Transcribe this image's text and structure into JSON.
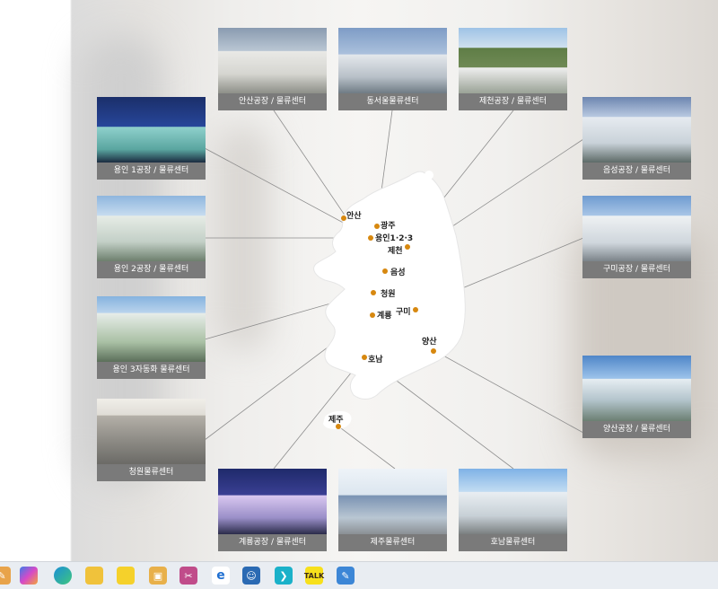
{
  "facilities": [
    {
      "id": "ansan",
      "caption": "안산공장 / 물류센터"
    },
    {
      "id": "dongseo",
      "caption": "동서울물류센터"
    },
    {
      "id": "jecheon",
      "caption": "제천공장 / 물류센터"
    },
    {
      "id": "yongin1",
      "caption": "용인 1공장 / 물류센터"
    },
    {
      "id": "eumseong",
      "caption": "음성공장 / 물류센터"
    },
    {
      "id": "yongin2",
      "caption": "용인 2공장 / 물류센터"
    },
    {
      "id": "gumi",
      "caption": "구미공장 / 물류센터"
    },
    {
      "id": "yongin3",
      "caption": "용인 3자동화 물류센터"
    },
    {
      "id": "yangsan",
      "caption": "양산공장 / 물류센터"
    },
    {
      "id": "cheongwon",
      "caption": "청원물류센터"
    },
    {
      "id": "gyeryong",
      "caption": "계룡공장 / 물류센터"
    },
    {
      "id": "jeju",
      "caption": "제주물류센터"
    },
    {
      "id": "honam",
      "caption": "호남물류센터"
    }
  ],
  "cities": {
    "ansan": "안산",
    "gwangju": "광주",
    "yongin": "용인1·2·3",
    "jecheon": "제천",
    "eumseong": "음성",
    "cheongwon": "청원",
    "gumi": "구미",
    "gyeryong": "계룡",
    "yangsan": "양산",
    "honam": "호남",
    "jeju": "제주"
  },
  "colors": {
    "marker": "#d7880f",
    "caption_bg": "#7a7a7a",
    "taskbar": "#e9edf2"
  },
  "taskbar": {
    "icons": [
      "pinned-app-icon",
      "copilot-icon",
      "edge-icon",
      "file-explorer-icon",
      "sticky-notes-icon",
      "store-icon",
      "snipping-icon",
      "internet-explorer-icon",
      "app-icon",
      "terminal-icon",
      "kakaotalk-icon",
      "notepad-icon"
    ]
  }
}
